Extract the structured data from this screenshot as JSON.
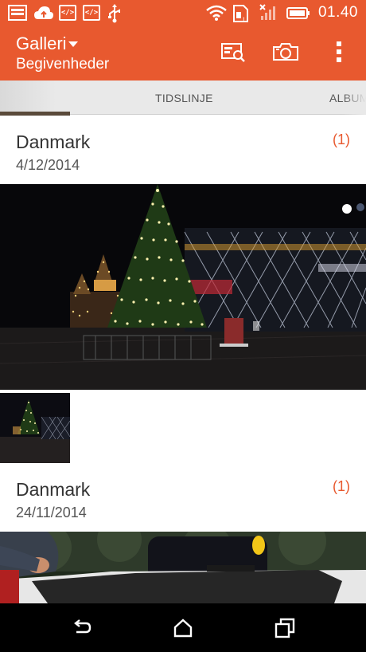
{
  "status_bar": {
    "icons_left": [
      "gallery-notification-icon",
      "cloud-upload-icon",
      "code-notification-icon",
      "code-notification-icon",
      "usb-icon"
    ],
    "code_glyph": "</>",
    "icons_right": [
      "wifi-icon",
      "sim-icon",
      "signal-icon",
      "battery-icon"
    ],
    "time": "01.40"
  },
  "action_bar": {
    "title": "Galleri",
    "subtitle": "Begivenheder",
    "actions": [
      "search-media-icon",
      "camera-icon",
      "overflow-menu-icon"
    ]
  },
  "tabs": [
    "TIDSLINJE",
    "ALBUM"
  ],
  "groups": [
    {
      "title": "Danmark",
      "date": "4/12/2014",
      "count": "(1)"
    },
    {
      "title": "Danmark",
      "date": "24/11/2014",
      "count": "(1)"
    }
  ],
  "nav_bar": {
    "buttons": [
      "back-icon",
      "home-icon",
      "recents-icon"
    ]
  },
  "colors": {
    "accent": "#e8592f",
    "nav": "#000000",
    "tab_bg": "#e9e9e9"
  }
}
